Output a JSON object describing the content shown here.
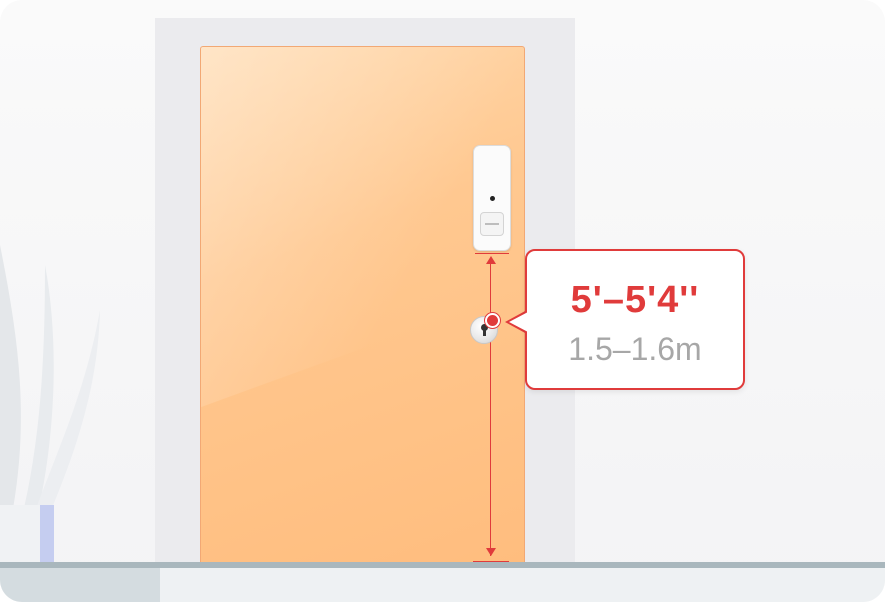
{
  "illustration": {
    "measurement": {
      "imperial": "5'–5'4''",
      "metric": "1.5–1.6m"
    }
  },
  "colors": {
    "accent_red": "#e03b3b",
    "door": "#ffc890",
    "metric_text": "#a7a7a7"
  },
  "icons": {
    "sensor": "contact-sensor-icon",
    "knob": "door-knob-icon",
    "plant": "plant-icon"
  }
}
